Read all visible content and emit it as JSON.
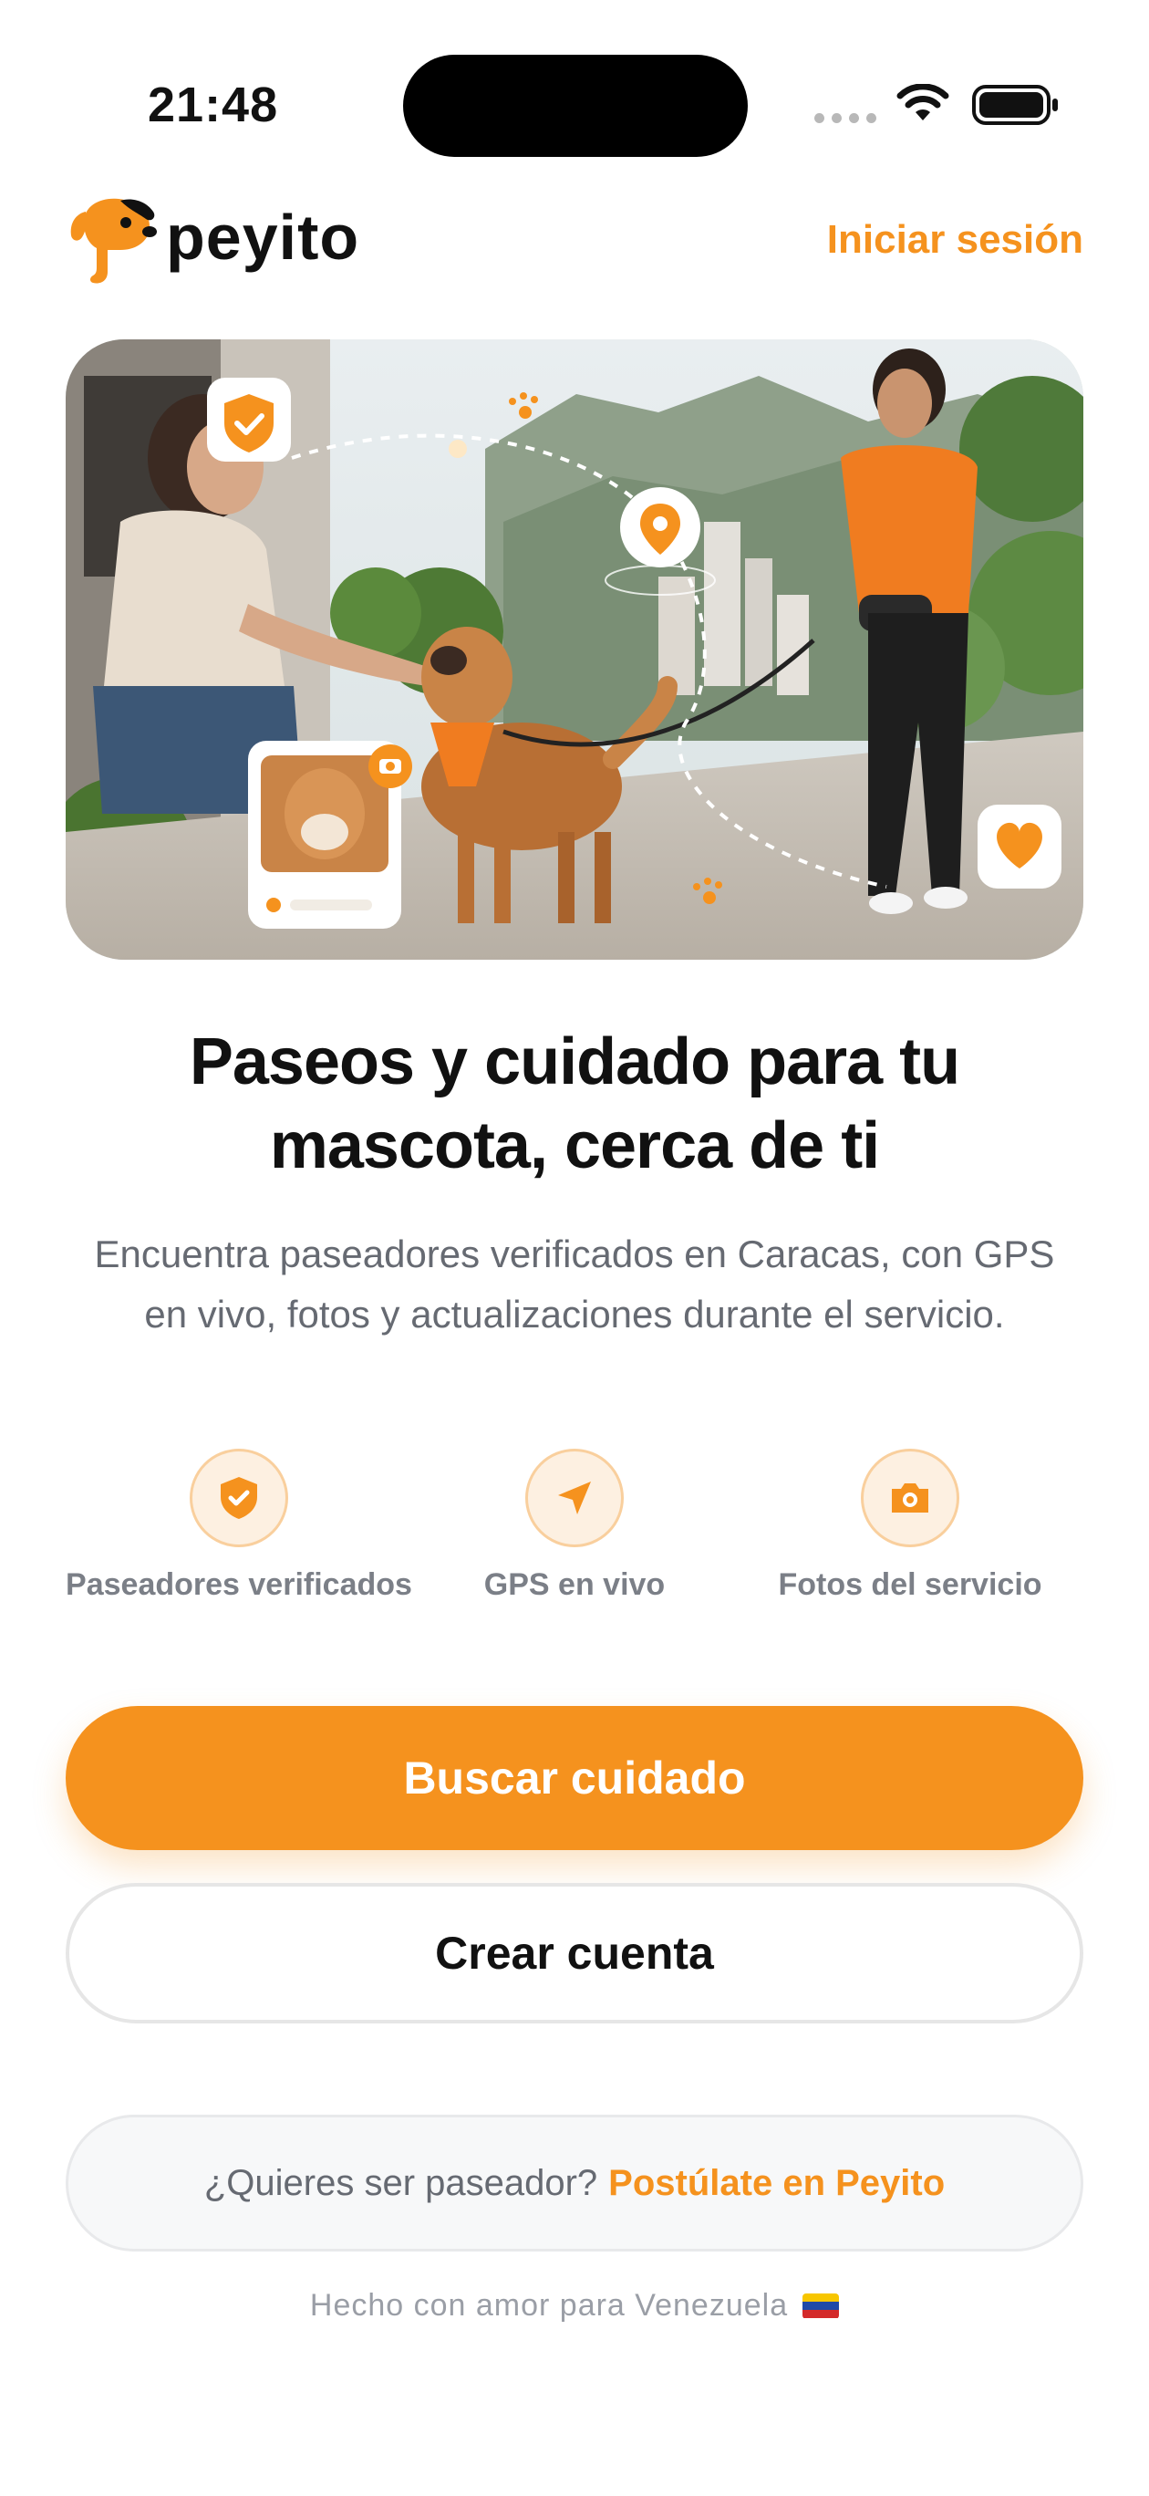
{
  "status_bar": {
    "time": "21:48"
  },
  "header": {
    "brand": "peyito",
    "login_label": "Iniciar sesión"
  },
  "hero": {
    "description_icons": [
      "shield-check-icon",
      "location-pin-icon",
      "paw-icon",
      "camera-icon",
      "heart-icon"
    ]
  },
  "headline": "Paseos y cuidado para tu mascota, cerca de ti",
  "subtitle": "Encuentra paseadores verificados en Caracas, con GPS en vivo, fotos y actualizaciones durante el servicio.",
  "features": [
    {
      "icon": "shield-check-icon",
      "label": "Paseadores verificados"
    },
    {
      "icon": "navigation-arrow-icon",
      "label": "GPS en vivo"
    },
    {
      "icon": "camera-icon",
      "label": "Fotos del servicio"
    }
  ],
  "actions": {
    "primary_label": "Buscar cuidado",
    "secondary_label": "Crear cuenta"
  },
  "walker_banner": {
    "question": "¿Quieres ser paseador?",
    "cta": "Postúlate en Peyito"
  },
  "footer": {
    "text": "Hecho con amor para Venezuela"
  },
  "colors": {
    "accent": "#f5921e",
    "accent_soft": "#fdf0e1",
    "text_primary": "#111111",
    "text_secondary": "#666a72"
  }
}
